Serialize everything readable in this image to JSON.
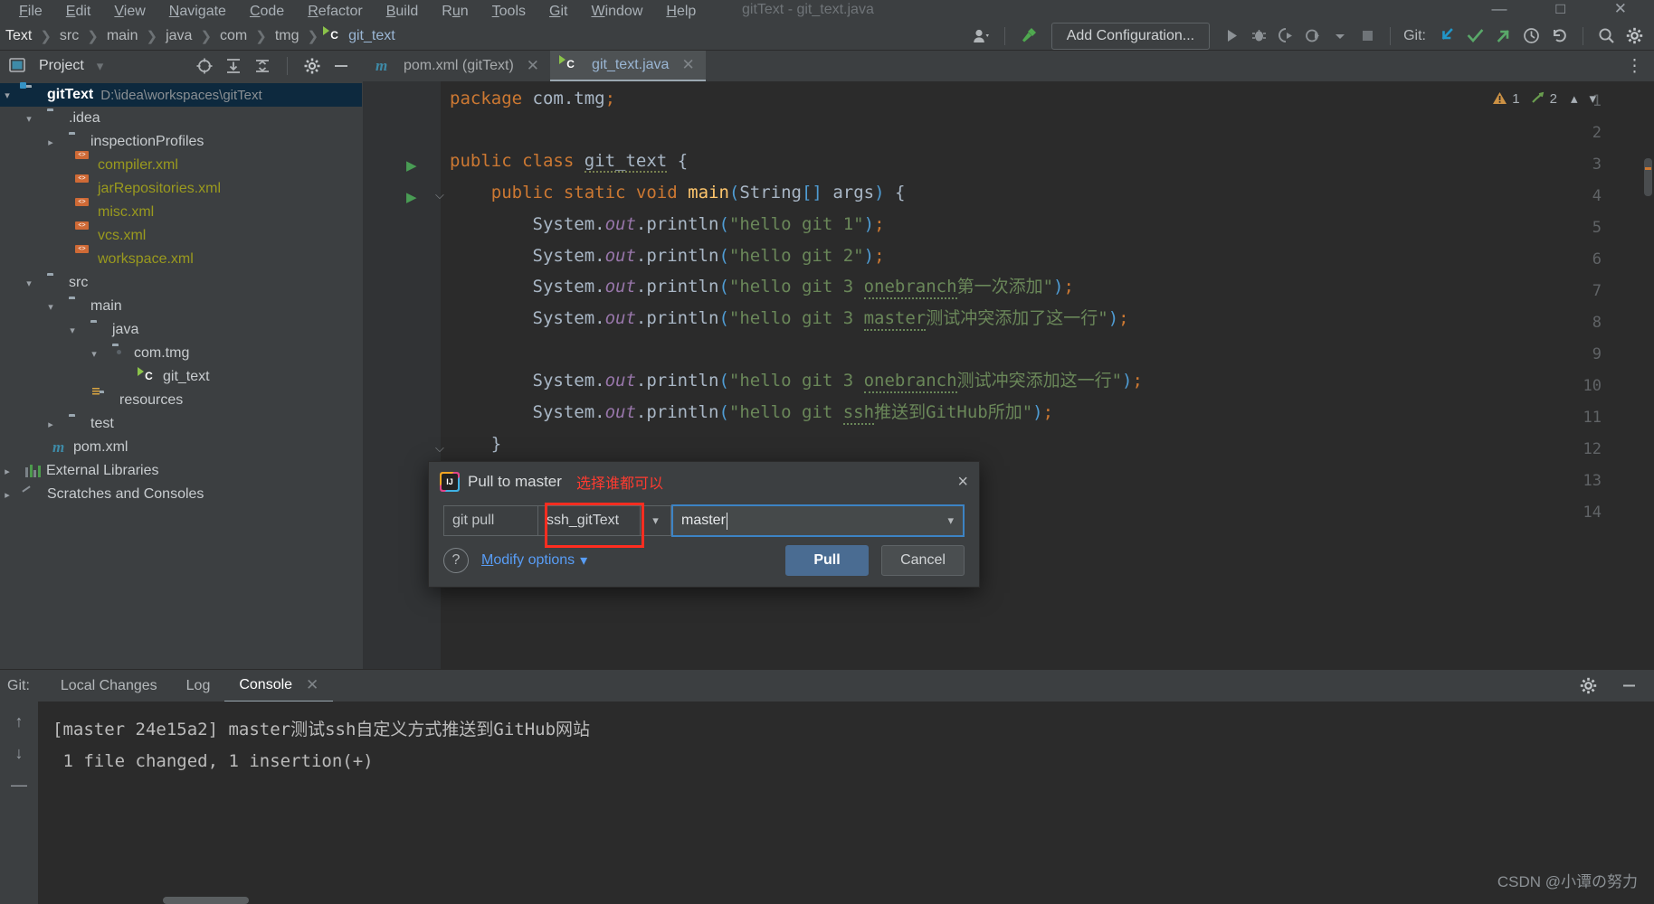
{
  "window": {
    "title": "gitText - git_text.java",
    "menus": [
      "File",
      "Edit",
      "View",
      "Navigate",
      "Code",
      "Refactor",
      "Build",
      "Run",
      "Tools",
      "Git",
      "Window",
      "Help"
    ]
  },
  "navbar": {
    "breadcrumbs": [
      "Text",
      "src",
      "main",
      "java",
      "com",
      "tmg",
      "git_text"
    ],
    "add_configuration_label": "Add Configuration...",
    "git_label": "Git:"
  },
  "project_panel": {
    "title": "Project",
    "tree": [
      {
        "label": "gitText",
        "path": "D:\\idea\\workspaces\\gitText",
        "indent": 0,
        "icon": "module-folder-icon",
        "arrow": "down",
        "selected": true,
        "bold": true
      },
      {
        "label": ".idea",
        "indent": 1,
        "icon": "folder-icon",
        "arrow": "down"
      },
      {
        "label": "inspectionProfiles",
        "indent": 2,
        "icon": "folder-icon",
        "arrow": "right"
      },
      {
        "label": "compiler.xml",
        "indent": 2,
        "icon": "xml-file-icon",
        "arrow": "none",
        "vcs": true
      },
      {
        "label": "jarRepositories.xml",
        "indent": 2,
        "icon": "xml-file-icon",
        "arrow": "none",
        "vcs": true
      },
      {
        "label": "misc.xml",
        "indent": 2,
        "icon": "xml-file-icon",
        "arrow": "none",
        "vcs": true
      },
      {
        "label": "vcs.xml",
        "indent": 2,
        "icon": "xml-file-icon",
        "arrow": "none",
        "vcs": true
      },
      {
        "label": "workspace.xml",
        "indent": 2,
        "icon": "xml-file-icon",
        "arrow": "none",
        "vcs": true
      },
      {
        "label": "src",
        "indent": 1,
        "icon": "folder-icon",
        "arrow": "down"
      },
      {
        "label": "main",
        "indent": 2,
        "icon": "folder-icon",
        "arrow": "down"
      },
      {
        "label": "java",
        "indent": 3,
        "icon": "sources-root-folder-icon",
        "arrow": "down"
      },
      {
        "label": "com.tmg",
        "indent": 4,
        "icon": "package-icon",
        "arrow": "down"
      },
      {
        "label": "git_text",
        "indent": 5,
        "icon": "java-class-icon",
        "arrow": "none"
      },
      {
        "label": "resources",
        "indent": 3,
        "icon": "resources-root-folder-icon",
        "arrow": "none"
      },
      {
        "label": "test",
        "indent": 2,
        "icon": "folder-icon",
        "arrow": "right"
      },
      {
        "label": "pom.xml",
        "indent": 1,
        "icon": "maven-icon",
        "arrow": "none"
      },
      {
        "label": "External Libraries",
        "indent": 0,
        "icon": "libraries-icon",
        "arrow": "right"
      },
      {
        "label": "Scratches and Consoles",
        "indent": 0,
        "icon": "scratches-icon",
        "arrow": "right"
      }
    ]
  },
  "editor": {
    "tabs": [
      {
        "label": "pom.xml (gitText)",
        "icon": "maven-icon",
        "active": false
      },
      {
        "label": "git_text.java",
        "icon": "java-class-icon",
        "active": true
      }
    ],
    "inspection": {
      "warnings": "1",
      "weak_warnings": "2"
    },
    "lines": [
      {
        "n": "1",
        "text": "package com.tmg;"
      },
      {
        "n": "2",
        "text": ""
      },
      {
        "n": "3",
        "text": "public class git_text {",
        "run": true
      },
      {
        "n": "4",
        "text": "    public static void main(String[] args) {",
        "run": true,
        "fold": true
      },
      {
        "n": "5",
        "text": "        System.out.println(\"hello git 1\");"
      },
      {
        "n": "6",
        "text": "        System.out.println(\"hello git 2\");"
      },
      {
        "n": "7",
        "text": "        System.out.println(\"hello git 3 onebranch第一次添加\");"
      },
      {
        "n": "8",
        "text": "        System.out.println(\"hello git 3 master测试冲突添加了这一行\");"
      },
      {
        "n": "9",
        "text": ""
      },
      {
        "n": "10",
        "text": "        System.out.println(\"hello git 3 onebranch测试冲突添加这一行\");"
      },
      {
        "n": "11",
        "text": "        System.out.println(\"hello git ssh推送到GitHub所加\");"
      },
      {
        "n": "12",
        "text": "    }",
        "fold": true
      },
      {
        "n": "13",
        "text": ""
      },
      {
        "n": "14",
        "text": ""
      }
    ]
  },
  "pull_dialog": {
    "title": "Pull to master",
    "annotation": "选择谁都可以",
    "command_label": "git pull",
    "remote_value": "ssh_gitText",
    "branch_value": "master",
    "modify_options_label": "Modify options",
    "help_label": "?",
    "pull_button": "Pull",
    "cancel_button": "Cancel",
    "close_icon": "×"
  },
  "git_panel": {
    "label": "Git:",
    "tabs": [
      {
        "label": "Local Changes",
        "active": false
      },
      {
        "label": "Log",
        "active": false
      },
      {
        "label": "Console",
        "active": true,
        "closeable": true
      }
    ],
    "console_lines": [
      "[master 24e15a2] master测试ssh自定义方式推送到GitHub网站",
      " 1 file changed, 1 insertion(+)"
    ]
  },
  "watermark": "CSDN @小谭の努力",
  "colors": {
    "accent_blue": "#3c83c4",
    "primary_button": "#4a6c92",
    "annotation_red": "#ff2d20",
    "string_green": "#6a8759",
    "keyword_orange": "#cc7832",
    "link_blue": "#589df6"
  }
}
